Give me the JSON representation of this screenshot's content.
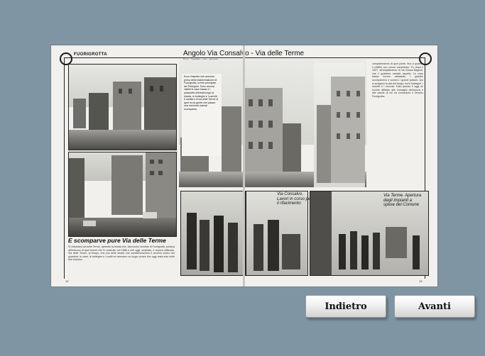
{
  "scan": {
    "running_header": "FUORIGROTTA",
    "headline_top": "Angolo Via Consalvo - Via delle Terme",
    "headline_bottom": "E scomparve pure Via delle Terme",
    "intro_text": "Ecco l'aspetto che assume, prima della trasformazione di Fuorigrotta, la fine principale dei Pellegrini. Sono ancora visibili le case basse e i palazzetti allineati lungo la strada, le botteghe e i carretti. Il cantiere di via delle Terme si apre tra la gente che passa: una memoria oramai scomparsa.",
    "body_text": "Si chiamava via delle Terme, aprendo la strada che, dal nucleo centrale di Fuorigrotta, portava all'imbocco di quel tunnel che fu costruito nel 1886 e che oggi, ampliato, è ancora utilizzato. Via delle Terme, al tempo, era una delle strade che caratterizzavano il vecchio centro del quartiere; le case, le botteghe e i cortili ne facevano un luogo vivace che oggi resta solo nelle foto d'epoca.",
    "right_col_text": "completamento di quel ponte, fino a quando il rettifilo non venne completato. Fu dopo il 1927, all'ampliamento di via Nuova Bagnoli, che il quartiere cambiò aspetto. Le case basse furono abbattute, i giardini scomparvero e sorsero i grandi palazzi. Qui si svolgeva la vita del borgo, tra le botteghe, i carretti e i mercati. Tutto questo è oggi un ricordo affidato alle immagini dell'epoca e alle parole di chi ha conosciuto il vecchio Fuorigrotta.",
    "caption_middle": "Via Consalvo. Lavori in corso per il rifacimento",
    "caption_right": "Via Terme. Apertura degli impianti a spese del Comune",
    "page_left": "12",
    "page_right": "13"
  },
  "nav": {
    "back_label": "Indietro",
    "next_label": "Avanti"
  },
  "colors": {
    "background": "#7f95a3",
    "paper": "#f1f0ec",
    "button_text": "#111111"
  }
}
